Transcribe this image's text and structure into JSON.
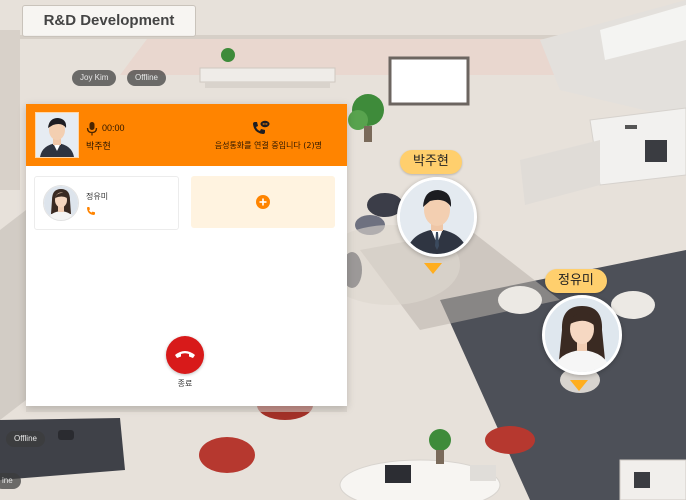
{
  "room": {
    "title": "R&D Development"
  },
  "status_chips": [
    {
      "label": "Joy Kim"
    },
    {
      "label": "Offline"
    },
    {
      "label": "Offline"
    },
    {
      "label": "ine"
    }
  ],
  "call": {
    "host_name": "박주현",
    "timer": "00:00",
    "status_text": "음성통화를 연결 중입니다 (2)명",
    "participants": [
      {
        "name": "정유미"
      }
    ],
    "hangup_label": "종료",
    "colors": {
      "header": "#ff8400",
      "hangup": "#d81a1a",
      "add_slot": "#fff3e0"
    }
  },
  "avatars": [
    {
      "name": "박주현"
    },
    {
      "name": "정유미"
    }
  ],
  "colors": {
    "name_bubble": "#ffcf6d",
    "pin": "#ffae1f"
  }
}
